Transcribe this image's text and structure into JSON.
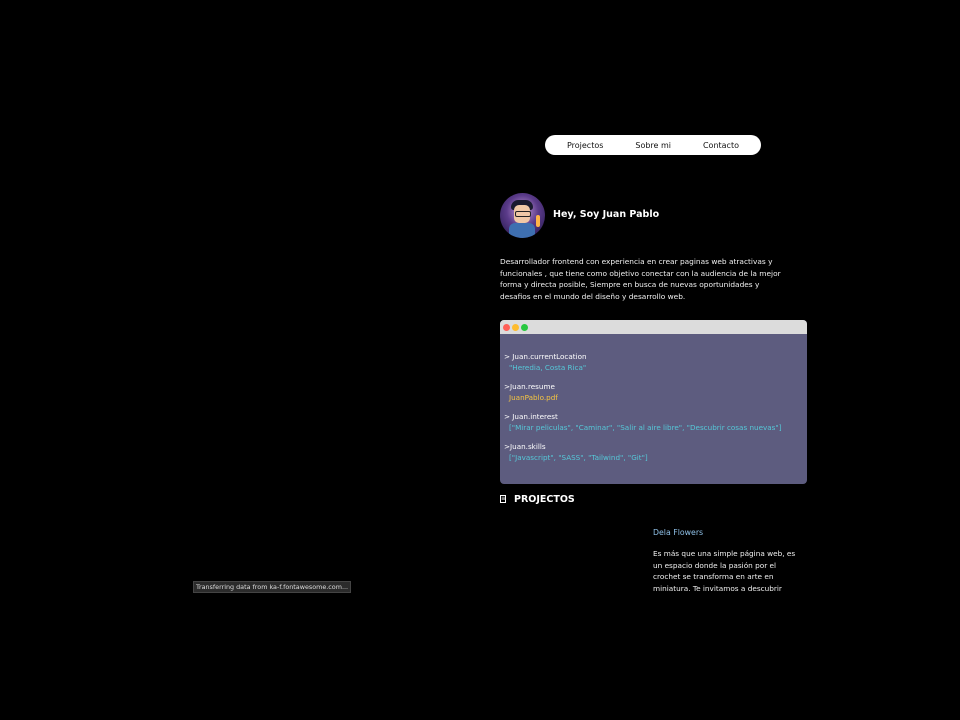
{
  "nav": {
    "items": [
      {
        "label": "Projectos"
      },
      {
        "label": "Sobre mi"
      },
      {
        "label": "Contacto"
      }
    ]
  },
  "hero": {
    "title": "Hey, Soy Juan Pablo",
    "bio": "Desarrollador frontend con experiencia en crear paginas web atractivas y funcionales , que tiene como objetivo conectar con la audiencia de la mejor forma y directa posible, Siempre en busca de nuevas oportunidades y desafios en el mundo del diseño y desarrollo web."
  },
  "terminal": {
    "colors": {
      "red": "#ff5f57",
      "yellow": "#febc2e",
      "green": "#28c840",
      "background": "#5d5c7f"
    },
    "lines": [
      {
        "cmd": "> Juan.currentLocation",
        "out": "\"Heredia, Costa Rica\""
      },
      {
        "cmd": ">Juan.resume",
        "out": "JuanPablo.pdf"
      },
      {
        "cmd": "> Juan.interest",
        "out": "[\"Mirar peliculas\", \"Caminar\", \"Salir al aire libre\", \"Descubrir cosas nuevas\"]"
      },
      {
        "cmd": ">Juan.skills",
        "out": "[\"Javascript\", \"SASS\", \"Tailwind\", \"Git\"]"
      }
    ]
  },
  "projects": {
    "title": "PROJECTOS",
    "icon": "file-icon",
    "items": [
      {
        "name": "Dela Flowers",
        "description": "Es más que una simple página web, es un espacio donde la pasión por el crochet se transforma en arte en miniatura. Te invitamos a descubrir"
      }
    ]
  },
  "status_bar": {
    "text": "Transferring data from ka-f.fontawesome.com..."
  }
}
